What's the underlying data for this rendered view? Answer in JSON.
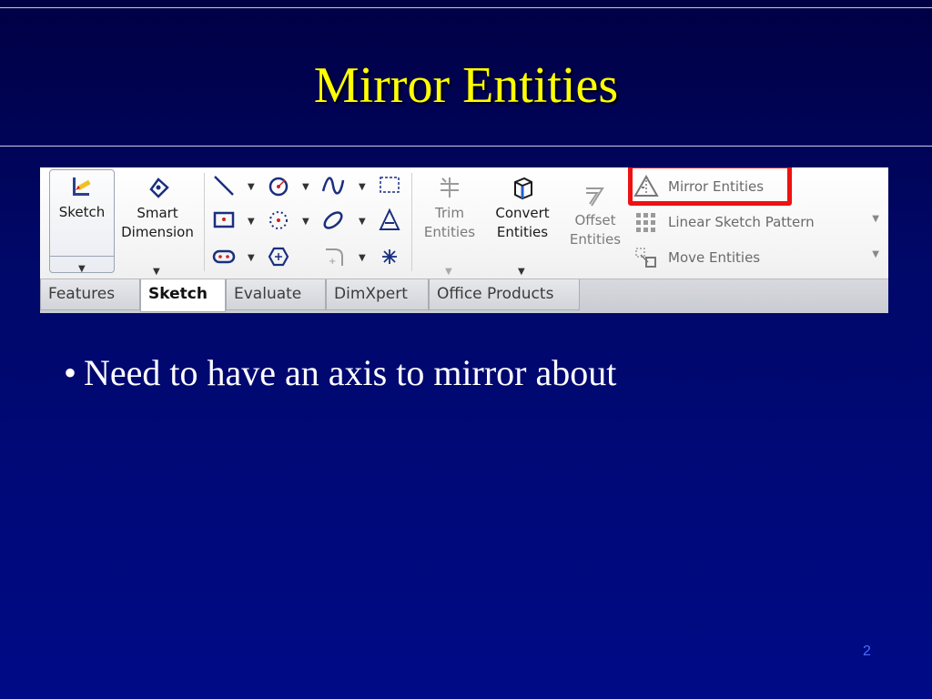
{
  "slide": {
    "title": "Mirror Entities",
    "bullet": "Need to have an axis to mirror about",
    "page_number": "2"
  },
  "ribbon": {
    "sketch_label": "Sketch",
    "smart_dimension_label": "Smart Dimension",
    "trim_label": "Trim Entities",
    "convert_label": "Convert Entities",
    "offset_label": "Offset Entities",
    "mirror_entities_label": "Mirror Entities",
    "linear_pattern_label": "Linear Sketch Pattern",
    "move_entities_label": "Move Entities"
  },
  "tabs": [
    "Features",
    "Sketch",
    "Evaluate",
    "DimXpert",
    "Office Products"
  ],
  "active_tab": "Sketch",
  "colors": {
    "title": "#ffff00",
    "highlight": "#ee1111",
    "background": "#00086a"
  }
}
